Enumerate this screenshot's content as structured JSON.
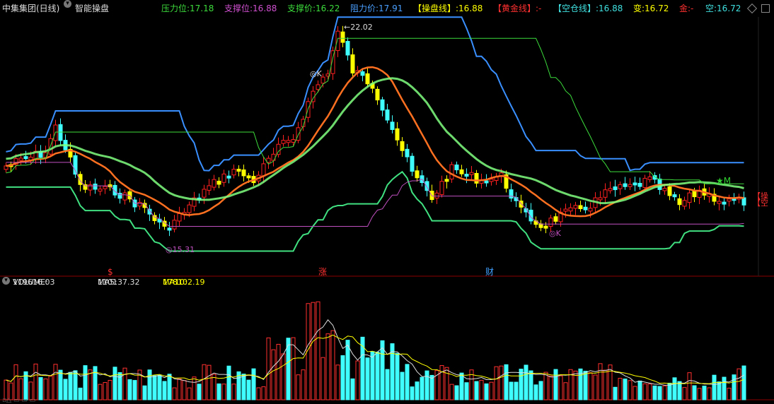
{
  "title": {
    "stock": "中集集团(日线)",
    "indicator": "智能操盘"
  },
  "header_values": [
    {
      "label": "压力位:",
      "value": "17.18",
      "color": "#3cdc3c"
    },
    {
      "label": "支撑位:",
      "value": "16.88",
      "color": "#d050d0"
    },
    {
      "label": "支撑价:",
      "value": "16.22",
      "color": "#3cdc3c"
    },
    {
      "label": "阻力价:",
      "value": "17.91",
      "color": "#4a9fff"
    },
    {
      "label": "【操盘线】:",
      "value": "16.88",
      "color": "#ffff00"
    },
    {
      "label": "【黄金线】:",
      "value": "-",
      "color": "#ff3030"
    },
    {
      "label": "【空仓线】:",
      "value": "16.88",
      "color": "#40e0e0"
    },
    {
      "label": "变:",
      "value": "16.72",
      "color": "#ffff00"
    },
    {
      "label": "金:",
      "value": "-",
      "color": "#ff3030"
    },
    {
      "label": "空:",
      "value": "16.72",
      "color": "#40e0e0"
    }
  ],
  "price_panel": {
    "high_label": "22.02",
    "low_label": "15.31",
    "signal_k": "K",
    "signal_m": "M",
    "bottom_markers": [
      "$",
      "涨",
      "财"
    ],
    "right_labels": [
      "【操",
      "【空"
    ],
    "colors": {
      "up": "#ff2020",
      "down": "#40ffff",
      "strong": "#ffff00",
      "resist": "#3a8fff",
      "support": "#40e080"
    }
  },
  "volume_panel": {
    "label_volume": "VOLUME:",
    "value_volume": "119616.03",
    "label_ma5": "MA5:",
    "value_ma5": "110137.32",
    "label_ma10": "MA10:",
    "value_ma10": "178102.19"
  },
  "bottom_text": "▫△ ▭ ▭ ▭"
}
